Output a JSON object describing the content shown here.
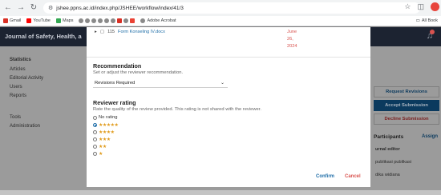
{
  "browser": {
    "url": "jshee.ppns.ac.id/index.php/JSHEE/workflow/index/41/3",
    "bookmarks": [
      {
        "label": "Gmail",
        "color": "#d93025"
      },
      {
        "label": "YouTube",
        "color": "#ff0000"
      },
      {
        "label": "Maps",
        "color": "#34a853"
      }
    ],
    "bookmark_extra": "Adobe Acrobat",
    "all_bookmarks": "All Book"
  },
  "page": {
    "journal_title": "Journal of Safety, Health, a",
    "sidebar": {
      "heading": "Statistics",
      "items": [
        "Articles",
        "Editorial Activity",
        "Users",
        "Reports"
      ],
      "tools": "Tools",
      "administration": "Administration"
    },
    "right": {
      "request_revisions": "Request Revisions",
      "accept_submission": "Accept Submission",
      "decline_submission": "Decline Submission",
      "participants": "Participants",
      "assign": "Assign",
      "role": "urnal editor",
      "people": [
        "publikasi publikasi",
        "dika widiana"
      ]
    }
  },
  "modal": {
    "file": {
      "id": "115",
      "name": "Form Konseling IV.docx",
      "date_lines": [
        "June",
        "26,",
        "2024"
      ]
    },
    "recommendation": {
      "title": "Recommendation",
      "description": "Set or adjust the reviewer recommendation.",
      "selected": "Revisions Required"
    },
    "rating": {
      "title": "Reviewer rating",
      "description": "Rate the quality of the review provided. This rating is not shared with the reviewer.",
      "options": [
        {
          "label": "No rating",
          "stars": ""
        },
        {
          "label": "",
          "stars": "★★★★★",
          "selected": true
        },
        {
          "label": "",
          "stars": "★★★★"
        },
        {
          "label": "",
          "stars": "★★★"
        },
        {
          "label": "",
          "stars": "★★"
        },
        {
          "label": "",
          "stars": "★"
        }
      ]
    },
    "confirm": "Confirm",
    "cancel": "Cancel"
  },
  "colors": {
    "header": "#1c2331",
    "accent": "#1f6ea8",
    "danger": "#d9534f",
    "star": "#e09a1a"
  }
}
